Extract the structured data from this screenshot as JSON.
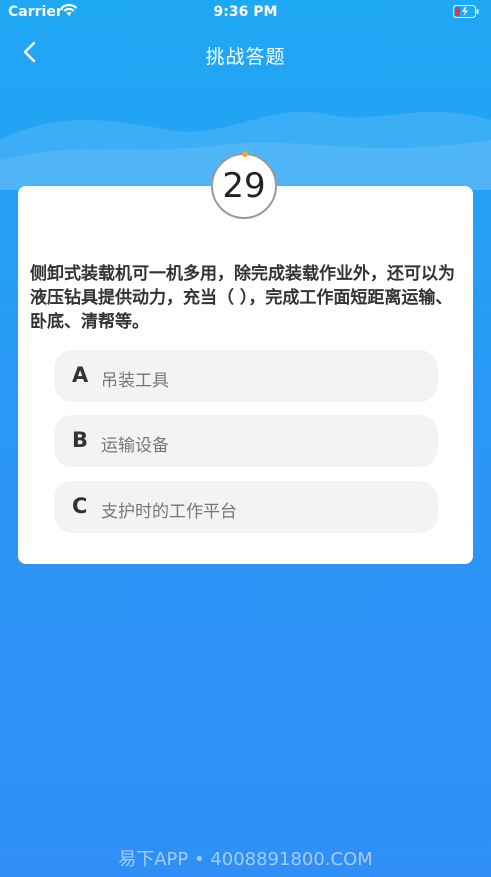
{
  "status": {
    "carrier": "Carrier",
    "time": "9:36 PM"
  },
  "nav": {
    "title": "挑战答题"
  },
  "timer": {
    "value": "29"
  },
  "question": {
    "text": "侧卸式装载机可一机多用，除完成装载作业外，还可以为液压钻具提供动力，充当（ ），完成工作面短距离运输、卧底、清帮等。"
  },
  "options": [
    {
      "letter": "A",
      "text": "吊装工具"
    },
    {
      "letter": "B",
      "text": "运输设备"
    },
    {
      "letter": "C",
      "text": "支护时的工作平台"
    }
  ],
  "footer": {
    "watermark": "易下APP • 4008891800.COM"
  },
  "colors": {
    "bg_top": "#1fa8f4",
    "bg_bottom": "#2f8ff6",
    "timer_dot": "#f5a623"
  },
  "icons": {
    "back": "chevron-left-icon",
    "wifi": "wifi-icon",
    "battery": "battery-charging-icon"
  }
}
